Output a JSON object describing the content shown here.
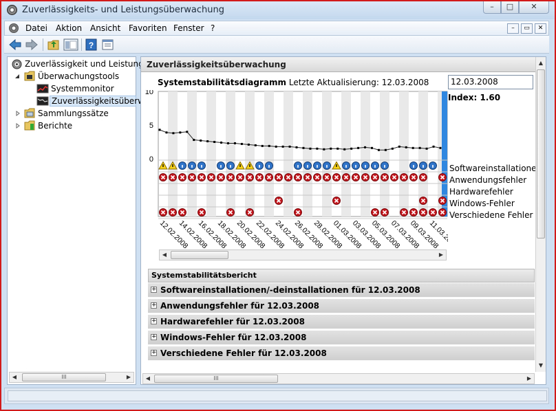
{
  "window": {
    "title": "Zuverlässigkeits- und Leistungsüberwachung",
    "min": "–",
    "max": "□",
    "close": "✕"
  },
  "menubar": {
    "items": [
      "Datei",
      "Aktion",
      "Ansicht",
      "Favoriten",
      "Fenster",
      "?"
    ],
    "mdi": [
      "–",
      "▭",
      "✕"
    ]
  },
  "toolbar": {
    "icons": [
      "back-icon",
      "forward-icon",
      "folder-up-icon",
      "show-hide-tree-icon",
      "help-icon",
      "properties-icon"
    ]
  },
  "tree": {
    "root": "Zuverlässigkeit und Leistung",
    "tools": "Überwachungstools",
    "sysmon": "Systemmonitor",
    "reliability": "Zuverlässigkeitsüberwa",
    "sets": "Sammlungssätze",
    "reports": "Berichte"
  },
  "main": {
    "header": "Zuverlässigkeitsüberwachung",
    "chart_title": "Systemstabilitätsdiagramm",
    "last_update": "Letzte Aktualisierung: 12.03.2008",
    "date_value": "12.03.2008",
    "index": "Index: 1.60"
  },
  "chart_data": {
    "type": "line",
    "title": "Systemstabilitätsdiagramm",
    "ylim": [
      0,
      10
    ],
    "yticks": [
      "10",
      "5",
      "0"
    ],
    "x_labels": [
      "12.02.2008",
      "14.02.2008",
      "16.02.2008",
      "18.02.2008",
      "20.02.2008",
      "22.02.2008",
      "24.02.2008",
      "26.02.2008",
      "28.02.2008",
      "01.03.2008",
      "03.03.2008",
      "05.03.2008",
      "07.03.2008",
      "09.03.2008",
      "11.03.2008"
    ],
    "values": [
      4.3,
      3.9,
      3.8,
      3.9,
      4.0,
      2.8,
      2.7,
      2.6,
      2.5,
      2.4,
      2.3,
      2.3,
      2.2,
      2.1,
      2.0,
      1.9,
      1.9,
      1.8,
      1.8,
      1.8,
      1.7,
      1.6,
      1.5,
      1.5,
      1.4,
      1.5,
      1.5,
      1.4,
      1.5,
      1.6,
      1.7,
      1.6,
      1.3,
      1.3,
      1.5,
      1.8,
      1.7,
      1.6,
      1.6,
      1.5,
      1.8,
      1.6
    ],
    "event_rows": [
      {
        "name": "Softwareinstallationen/",
        "marks": [
          [
            0,
            "w"
          ],
          [
            1,
            "w"
          ],
          [
            2,
            "i"
          ],
          [
            3,
            "i"
          ],
          [
            4,
            "i"
          ],
          [
            6,
            "i"
          ],
          [
            7,
            "i"
          ],
          [
            8,
            "w"
          ],
          [
            9,
            "w"
          ],
          [
            10,
            "i"
          ],
          [
            11,
            "i"
          ],
          [
            14,
            "i"
          ],
          [
            15,
            "i"
          ],
          [
            16,
            "i"
          ],
          [
            17,
            "i"
          ],
          [
            18,
            "w"
          ],
          [
            19,
            "i"
          ],
          [
            20,
            "i"
          ],
          [
            21,
            "i"
          ],
          [
            22,
            "i"
          ],
          [
            23,
            "i"
          ],
          [
            26,
            "i"
          ],
          [
            27,
            "i"
          ],
          [
            28,
            "i"
          ]
        ]
      },
      {
        "name": "Anwendungsfehler",
        "marks": [
          [
            0,
            "e"
          ],
          [
            1,
            "e"
          ],
          [
            2,
            "e"
          ],
          [
            3,
            "e"
          ],
          [
            4,
            "e"
          ],
          [
            5,
            "e"
          ],
          [
            6,
            "e"
          ],
          [
            7,
            "e"
          ],
          [
            8,
            "e"
          ],
          [
            9,
            "e"
          ],
          [
            10,
            "e"
          ],
          [
            11,
            "e"
          ],
          [
            12,
            "e"
          ],
          [
            13,
            "e"
          ],
          [
            14,
            "e"
          ],
          [
            15,
            "e"
          ],
          [
            16,
            "e"
          ],
          [
            17,
            "e"
          ],
          [
            18,
            "e"
          ],
          [
            19,
            "e"
          ],
          [
            20,
            "e"
          ],
          [
            21,
            "e"
          ],
          [
            22,
            "e"
          ],
          [
            23,
            "e"
          ],
          [
            24,
            "e"
          ],
          [
            25,
            "e"
          ],
          [
            26,
            "e"
          ],
          [
            27,
            "e"
          ],
          [
            29,
            "e"
          ]
        ]
      },
      {
        "name": "Hardwarefehler",
        "marks": []
      },
      {
        "name": "Windows-Fehler",
        "marks": [
          [
            12,
            "e"
          ],
          [
            18,
            "e"
          ],
          [
            27,
            "e"
          ],
          [
            29,
            "e"
          ]
        ]
      },
      {
        "name": "Verschiedene Fehler",
        "marks": [
          [
            0,
            "e"
          ],
          [
            1,
            "e"
          ],
          [
            2,
            "e"
          ],
          [
            4,
            "e"
          ],
          [
            7,
            "e"
          ],
          [
            9,
            "e"
          ],
          [
            14,
            "e"
          ],
          [
            22,
            "e"
          ],
          [
            23,
            "e"
          ],
          [
            25,
            "e"
          ],
          [
            26,
            "e"
          ],
          [
            27,
            "e"
          ],
          [
            28,
            "e"
          ],
          [
            29,
            "e"
          ]
        ]
      }
    ]
  },
  "report": {
    "header": "Systemstabilitätsbericht",
    "rows": [
      "Softwareinstallationen/-deinstallationen für 12.03.2008",
      "Anwendungsfehler für 12.03.2008",
      "Hardwarefehler für 12.03.2008",
      "Windows-Fehler für 12.03.2008",
      "Verschiedene Fehler für 12.03.2008"
    ],
    "expand": "+"
  },
  "scroll": {
    "grip": "III",
    "left": "◀",
    "right": "▶",
    "up": "▲",
    "down": "▼"
  }
}
